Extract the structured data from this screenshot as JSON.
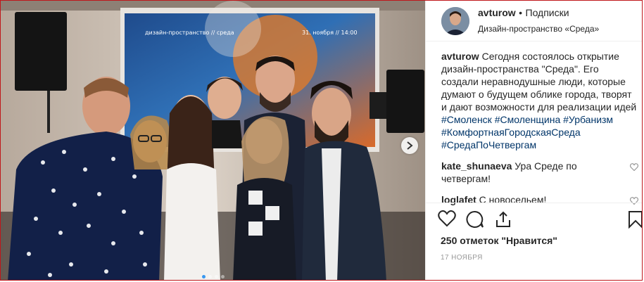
{
  "post": {
    "username": "avturow",
    "separator": "•",
    "follow_label": "Подписки",
    "location": "Дизайн-пространство «Среда»",
    "caption_user": "avturow",
    "caption_text": "Сегодня состоялось открытие дизайн-пространства \"Среда\". Его создали неравнодушные люди, которые думают о будущем облике города, творят и дают возможности для реализации идей",
    "hashtags": [
      "#Смоленск",
      "#Смоленщина",
      "#Урбанизм",
      "#КомфортнаяГородскаяСреда",
      "#СредаПоЧетвергам"
    ],
    "comments": [
      {
        "user": "kate_shunaeva",
        "text": "Ура Среде по четвергам!"
      },
      {
        "user": "loglafet",
        "text": "С новосельем!"
      }
    ],
    "likes_label": "250 отметок \"Нравится\"",
    "date_label": "17 НОЯБРЯ"
  },
  "photo": {
    "screen_text_top": "дизайн-пространство // среда",
    "screen_text_date": "31. ноября // 14:00",
    "carousel_count": 4,
    "carousel_active": 1
  },
  "colors": {
    "link": "#003569",
    "carousel_active": "#3897f0",
    "border": "#c0161a"
  }
}
